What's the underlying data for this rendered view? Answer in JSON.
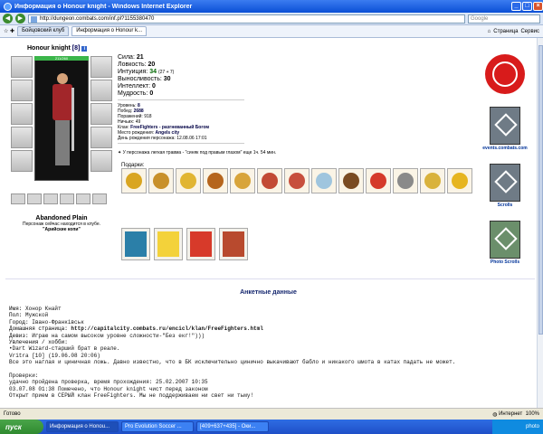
{
  "window": {
    "title": "Информация о Honour knight - Windows Internet Explorer"
  },
  "address": {
    "url": "http://dungeon.combats.com/inf.pl?1155380470",
    "search_placeholder": "Google"
  },
  "tabs": [
    {
      "label": "Бойцовский клуб"
    },
    {
      "label": "Информация о Honour k..."
    }
  ],
  "toolbar": {
    "page": "Страница",
    "tools": "Сервис"
  },
  "character": {
    "name": "Honour knight",
    "level": "[8]",
    "hp": "211/260",
    "location": "Abandoned Plain",
    "club_note": "Персонаж сейчас находится в клубе.",
    "club_name": "\"Арийские копи\""
  },
  "stats": [
    {
      "label": "Сила:",
      "value": "21",
      "extra": ""
    },
    {
      "label": "Ловкость:",
      "value": "20",
      "extra": ""
    },
    {
      "label": "Интуиция:",
      "value": "34",
      "extra": "(27 + 7)"
    },
    {
      "label": "Выносливость:",
      "value": "30",
      "extra": ""
    },
    {
      "label": "Интеллект:",
      "value": "0",
      "extra": ""
    },
    {
      "label": "Мудрость:",
      "value": "0",
      "extra": ""
    }
  ],
  "info": [
    {
      "label": "Уровень:",
      "value": "8"
    },
    {
      "label": "Побед:",
      "value": "2688"
    },
    {
      "label": "Поражений:",
      "value": "918"
    },
    {
      "label": "Ничьих:",
      "value": "49"
    },
    {
      "label": "Клан:",
      "value": "FreeFighters - разгневанный Богом"
    },
    {
      "label": "Место рождения:",
      "value": "Angels city"
    },
    {
      "label": "День рождения персонажа:",
      "value": "12.08.06 17:01"
    }
  ],
  "trauma": "У персонажа легкая травма - \"синяк под правым глазом\" еще 1ч. 54 мин.",
  "gifts_label": "Подарки:",
  "gift_colors": [
    "#d9a520",
    "#c8902a",
    "#e1b532",
    "#b5651d",
    "#d8a43a",
    "#c24a35",
    "#c74f3d",
    "#9fc5de",
    "#7a4b22",
    "#d53a2a",
    "#8a8a8a",
    "#d9b23c",
    "#e6b520"
  ],
  "gift2_colors": [
    "#2b7fa8",
    "#f3d23a",
    "#d73a2a",
    "#b84a2e"
  ],
  "right": {
    "link1": "events.combats.com",
    "link2": "Scrolls",
    "link3": "Photo Scrolls"
  },
  "anketa": {
    "title": "Анкетные данные",
    "lines": [
      {
        "k": "Имя: ",
        "v": "Хонор Кнайт"
      },
      {
        "k": "Пол: ",
        "v": "Мужской"
      },
      {
        "k": "Город: ",
        "v": "Івано-Франківськ"
      },
      {
        "k": "Домашняя страница: ",
        "v": "http://capitalcity.combats.ru/encicl/klan/FreeFighters.html",
        "link": true
      },
      {
        "k": "Девиз: ",
        "v": "Играю на самом высоком уровне сложности-\"Без екг!\")))"
      },
      {
        "k": "Увлечения / хобби:",
        "v": ""
      },
      {
        "k": "",
        "v": "•Dart Wizard-старший брат в реале."
      },
      {
        "k": "",
        "v": "Vritra [10]    (19.06.08 20:06)"
      },
      {
        "k": "",
        "v": "Все это наглая и циничная ложь. Давно известно, что в БК исключительно цинично выкачивают бабло и никакого шмота в катах падать не может."
      },
      {
        "k": "",
        "v": ""
      },
      {
        "k": "",
        "v": "Проверки:"
      },
      {
        "k": "",
        "v": "удачно пройдена проверка, время прохождения: 25.02.2007 10:35"
      },
      {
        "k": "",
        "v": "03.07.08 01:38 Помечено, что Honour knight чист перед законом"
      },
      {
        "k": "",
        "v": "Открыт прием в СЕРЫЙ клан FreeFighters. Мы не поддерживаем ни свет ни тьму!"
      }
    ]
  },
  "status": {
    "left": "Готово",
    "zone": "Интернет",
    "zoom": "100%"
  },
  "taskbar": {
    "start": "пуск",
    "tasks": [
      {
        "label": "Информация о Honou..."
      },
      {
        "label": "Pro Evolution Soccer ..."
      },
      {
        "label": "[409+637+435] - Оки..."
      }
    ],
    "clock": "photo"
  }
}
